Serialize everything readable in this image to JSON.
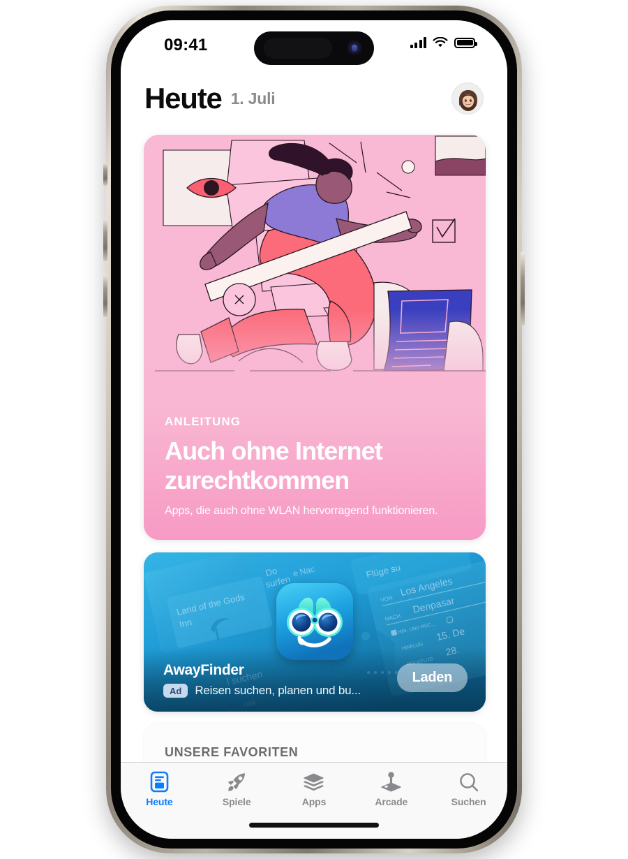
{
  "status_bar": {
    "time": "09:41",
    "cellular_icon": "signal-bars-icon",
    "wifi_icon": "wifi-icon",
    "battery_icon": "battery-full-icon"
  },
  "nav": {
    "title": "Heute",
    "date": "1. Juli",
    "avatar_icon": "memoji-avatar"
  },
  "feature_card": {
    "eyebrow": "ANLEITUNG",
    "headline": "Auch ohne Internet zurechtkommen",
    "subline": "Apps, die auch ohne WLAN hervorragend funktionieren.",
    "background_color": "#f9b7d3",
    "illustration_name": "woman-with-ruler-illustration"
  },
  "ad_card": {
    "app_name": "AwayFinder",
    "badge": "Ad",
    "tagline": "Reisen suchen, planen und bu...",
    "cta_label": "Laden",
    "app_icon_name": "awayfinder-binoculars-icon",
    "background_labels": [
      "Land of the Gods",
      "Inn",
      "Flüge su",
      "Los Angeles",
      "VON",
      "Denpasar",
      "NACH",
      "HIN- UND RÜC...",
      "15. De",
      "28.",
      "HINFLUG",
      "RÜCKFLUG",
      "l suchen",
      "surfen",
      "e Nac",
      "Do"
    ],
    "accent_color": "#1f93cd"
  },
  "favorites_card": {
    "section_title": "UNSERE FAVORITEN"
  },
  "tab_bar": {
    "active_color": "#0a7cff",
    "inactive_color": "#8a8a8e",
    "tabs": [
      {
        "label": "Heute",
        "icon": "today-document-icon",
        "active": true
      },
      {
        "label": "Spiele",
        "icon": "rocket-icon",
        "active": false
      },
      {
        "label": "Apps",
        "icon": "stack-layers-icon",
        "active": false
      },
      {
        "label": "Arcade",
        "icon": "joystick-icon",
        "active": false
      },
      {
        "label": "Suchen",
        "icon": "magnifier-icon",
        "active": false
      }
    ]
  }
}
